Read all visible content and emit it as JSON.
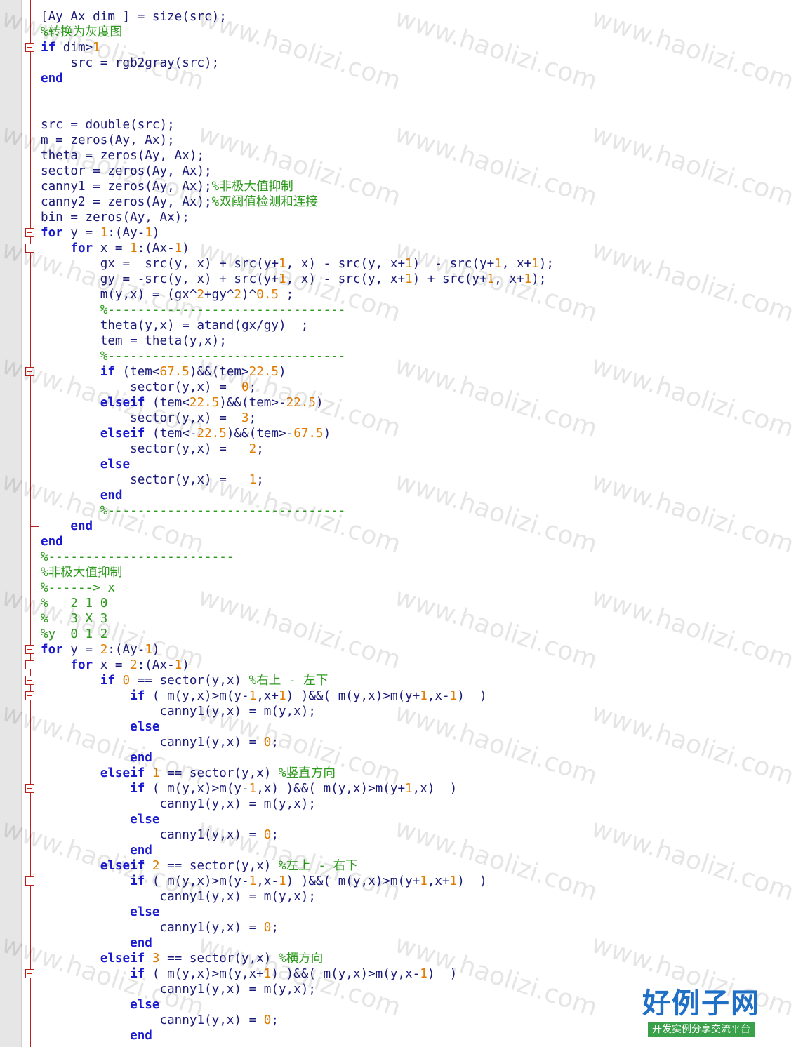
{
  "editor": {
    "lines": [
      [
        {
          "t": "[Ay Ax dim ] = size(src);",
          "c": "txt"
        }
      ],
      [
        {
          "t": "%转换为灰度图",
          "c": "cm"
        }
      ],
      [
        {
          "t": "if",
          "c": "kw"
        },
        {
          "t": " dim>",
          "c": "txt"
        },
        {
          "t": "1",
          "c": "num"
        }
      ],
      [
        {
          "t": "    src = rgb2gray(src);",
          "c": "txt"
        }
      ],
      [
        {
          "t": "end",
          "c": "kw"
        }
      ],
      [
        {
          "t": "",
          "c": "txt"
        }
      ],
      [
        {
          "t": "",
          "c": "txt"
        }
      ],
      [
        {
          "t": "src = double(src);",
          "c": "txt"
        }
      ],
      [
        {
          "t": "m = zeros(Ay, Ax);",
          "c": "txt"
        }
      ],
      [
        {
          "t": "theta = zeros(Ay, Ax);",
          "c": "txt"
        }
      ],
      [
        {
          "t": "sector = zeros(Ay, Ax);",
          "c": "txt"
        }
      ],
      [
        {
          "t": "canny1 = zeros(Ay, Ax);",
          "c": "txt"
        },
        {
          "t": "%非极大值抑制",
          "c": "cm"
        }
      ],
      [
        {
          "t": "canny2 = zeros(Ay, Ax);",
          "c": "txt"
        },
        {
          "t": "%双阈值检测和连接",
          "c": "cm"
        }
      ],
      [
        {
          "t": "bin = zeros(Ay, Ax);",
          "c": "txt"
        }
      ],
      [
        {
          "t": "for",
          "c": "kw"
        },
        {
          "t": " y = ",
          "c": "txt"
        },
        {
          "t": "1",
          "c": "num"
        },
        {
          "t": ":(Ay-",
          "c": "txt"
        },
        {
          "t": "1",
          "c": "num"
        },
        {
          "t": ")",
          "c": "txt"
        }
      ],
      [
        {
          "t": "    ",
          "c": "txt"
        },
        {
          "t": "for",
          "c": "kw"
        },
        {
          "t": " x = ",
          "c": "txt"
        },
        {
          "t": "1",
          "c": "num"
        },
        {
          "t": ":(Ax-",
          "c": "txt"
        },
        {
          "t": "1",
          "c": "num"
        },
        {
          "t": ")",
          "c": "txt"
        }
      ],
      [
        {
          "t": "        gx =  src(y, x) + src(y+",
          "c": "txt"
        },
        {
          "t": "1",
          "c": "num"
        },
        {
          "t": ", x) - src(y, x+",
          "c": "txt"
        },
        {
          "t": "1",
          "c": "num"
        },
        {
          "t": ")  - src(y+",
          "c": "txt"
        },
        {
          "t": "1",
          "c": "num"
        },
        {
          "t": ", x+",
          "c": "txt"
        },
        {
          "t": "1",
          "c": "num"
        },
        {
          "t": ");",
          "c": "txt"
        }
      ],
      [
        {
          "t": "        gy = -src(y, x) + src(y+",
          "c": "txt"
        },
        {
          "t": "1",
          "c": "num"
        },
        {
          "t": ", x) - src(y, x+",
          "c": "txt"
        },
        {
          "t": "1",
          "c": "num"
        },
        {
          "t": ") + src(y+",
          "c": "txt"
        },
        {
          "t": "1",
          "c": "num"
        },
        {
          "t": ", x+",
          "c": "txt"
        },
        {
          "t": "1",
          "c": "num"
        },
        {
          "t": ");",
          "c": "txt"
        }
      ],
      [
        {
          "t": "        m(y,x) = (gx^",
          "c": "txt"
        },
        {
          "t": "2",
          "c": "num"
        },
        {
          "t": "+gy^",
          "c": "txt"
        },
        {
          "t": "2",
          "c": "num"
        },
        {
          "t": ")^",
          "c": "txt"
        },
        {
          "t": "0.5",
          "c": "num"
        },
        {
          "t": " ;",
          "c": "txt"
        }
      ],
      [
        {
          "t": "        ",
          "c": "txt"
        },
        {
          "t": "%--------------------------------",
          "c": "cm"
        }
      ],
      [
        {
          "t": "        theta(y,x) = atand(gx/gy)  ;",
          "c": "txt"
        }
      ],
      [
        {
          "t": "        tem = theta(y,x);",
          "c": "txt"
        }
      ],
      [
        {
          "t": "        ",
          "c": "txt"
        },
        {
          "t": "%--------------------------------",
          "c": "cm"
        }
      ],
      [
        {
          "t": "        ",
          "c": "txt"
        },
        {
          "t": "if",
          "c": "kw"
        },
        {
          "t": " (tem<",
          "c": "txt"
        },
        {
          "t": "67.5",
          "c": "num"
        },
        {
          "t": ")&&(tem>",
          "c": "txt"
        },
        {
          "t": "22.5",
          "c": "num"
        },
        {
          "t": ")",
          "c": "txt"
        }
      ],
      [
        {
          "t": "            sector(y,x) =  ",
          "c": "txt"
        },
        {
          "t": "0",
          "c": "num"
        },
        {
          "t": ";",
          "c": "txt"
        }
      ],
      [
        {
          "t": "        ",
          "c": "txt"
        },
        {
          "t": "elseif",
          "c": "kw"
        },
        {
          "t": " (tem<",
          "c": "txt"
        },
        {
          "t": "22.5",
          "c": "num"
        },
        {
          "t": ")&&(tem>-",
          "c": "txt"
        },
        {
          "t": "22.5",
          "c": "num"
        },
        {
          "t": ")",
          "c": "txt"
        }
      ],
      [
        {
          "t": "            sector(y,x) =  ",
          "c": "txt"
        },
        {
          "t": "3",
          "c": "num"
        },
        {
          "t": ";",
          "c": "txt"
        }
      ],
      [
        {
          "t": "        ",
          "c": "txt"
        },
        {
          "t": "elseif",
          "c": "kw"
        },
        {
          "t": " (tem<-",
          "c": "txt"
        },
        {
          "t": "22.5",
          "c": "num"
        },
        {
          "t": ")&&(tem>-",
          "c": "txt"
        },
        {
          "t": "67.5",
          "c": "num"
        },
        {
          "t": ")",
          "c": "txt"
        }
      ],
      [
        {
          "t": "            sector(y,x) =   ",
          "c": "txt"
        },
        {
          "t": "2",
          "c": "num"
        },
        {
          "t": ";",
          "c": "txt"
        }
      ],
      [
        {
          "t": "        ",
          "c": "txt"
        },
        {
          "t": "else",
          "c": "kw"
        }
      ],
      [
        {
          "t": "            sector(y,x) =   ",
          "c": "txt"
        },
        {
          "t": "1",
          "c": "num"
        },
        {
          "t": ";",
          "c": "txt"
        }
      ],
      [
        {
          "t": "        ",
          "c": "txt"
        },
        {
          "t": "end",
          "c": "kw"
        }
      ],
      [
        {
          "t": "        ",
          "c": "txt"
        },
        {
          "t": "%--------------------------------",
          "c": "cm"
        }
      ],
      [
        {
          "t": "    ",
          "c": "txt"
        },
        {
          "t": "end",
          "c": "kw"
        }
      ],
      [
        {
          "t": "end",
          "c": "kw"
        }
      ],
      [
        {
          "t": "%-------------------------",
          "c": "cm"
        }
      ],
      [
        {
          "t": "%非极大值抑制",
          "c": "cm"
        }
      ],
      [
        {
          "t": "%------> x",
          "c": "cm"
        }
      ],
      [
        {
          "t": "%   2 1 0",
          "c": "cm"
        }
      ],
      [
        {
          "t": "%   3 X 3",
          "c": "cm"
        }
      ],
      [
        {
          "t": "%y  0 1 2",
          "c": "cm"
        }
      ],
      [
        {
          "t": "for",
          "c": "kw"
        },
        {
          "t": " y = ",
          "c": "txt"
        },
        {
          "t": "2",
          "c": "num"
        },
        {
          "t": ":(Ay-",
          "c": "txt"
        },
        {
          "t": "1",
          "c": "num"
        },
        {
          "t": ")",
          "c": "txt"
        }
      ],
      [
        {
          "t": "    ",
          "c": "txt"
        },
        {
          "t": "for",
          "c": "kw"
        },
        {
          "t": " x = ",
          "c": "txt"
        },
        {
          "t": "2",
          "c": "num"
        },
        {
          "t": ":(Ax-",
          "c": "txt"
        },
        {
          "t": "1",
          "c": "num"
        },
        {
          "t": ")",
          "c": "txt"
        }
      ],
      [
        {
          "t": "        ",
          "c": "txt"
        },
        {
          "t": "if",
          "c": "kw"
        },
        {
          "t": " ",
          "c": "txt"
        },
        {
          "t": "0",
          "c": "num"
        },
        {
          "t": " == sector(y,x) ",
          "c": "txt"
        },
        {
          "t": "%右上 - 左下",
          "c": "cm"
        }
      ],
      [
        {
          "t": "            ",
          "c": "txt"
        },
        {
          "t": "if",
          "c": "kw"
        },
        {
          "t": " ( m(y,x)>m(y-",
          "c": "txt"
        },
        {
          "t": "1",
          "c": "num"
        },
        {
          "t": ",x+",
          "c": "txt"
        },
        {
          "t": "1",
          "c": "num"
        },
        {
          "t": ") )&&( m(y,x)>m(y+",
          "c": "txt"
        },
        {
          "t": "1",
          "c": "num"
        },
        {
          "t": ",x-",
          "c": "txt"
        },
        {
          "t": "1",
          "c": "num"
        },
        {
          "t": ")  )",
          "c": "txt"
        }
      ],
      [
        {
          "t": "                canny1(y,x) = m(y,x);",
          "c": "txt"
        }
      ],
      [
        {
          "t": "            ",
          "c": "txt"
        },
        {
          "t": "else",
          "c": "kw"
        }
      ],
      [
        {
          "t": "                canny1(y,x) = ",
          "c": "txt"
        },
        {
          "t": "0",
          "c": "num"
        },
        {
          "t": ";",
          "c": "txt"
        }
      ],
      [
        {
          "t": "            ",
          "c": "txt"
        },
        {
          "t": "end",
          "c": "kw"
        }
      ],
      [
        {
          "t": "        ",
          "c": "txt"
        },
        {
          "t": "elseif",
          "c": "kw"
        },
        {
          "t": " ",
          "c": "txt"
        },
        {
          "t": "1",
          "c": "num"
        },
        {
          "t": " == sector(y,x) ",
          "c": "txt"
        },
        {
          "t": "%竖直方向",
          "c": "cm"
        }
      ],
      [
        {
          "t": "            ",
          "c": "txt"
        },
        {
          "t": "if",
          "c": "kw"
        },
        {
          "t": " ( m(y,x)>m(y-",
          "c": "txt"
        },
        {
          "t": "1",
          "c": "num"
        },
        {
          "t": ",x) )&&( m(y,x)>m(y+",
          "c": "txt"
        },
        {
          "t": "1",
          "c": "num"
        },
        {
          "t": ",x)  )",
          "c": "txt"
        }
      ],
      [
        {
          "t": "                canny1(y,x) = m(y,x);",
          "c": "txt"
        }
      ],
      [
        {
          "t": "            ",
          "c": "txt"
        },
        {
          "t": "else",
          "c": "kw"
        }
      ],
      [
        {
          "t": "                canny1(y,x) = ",
          "c": "txt"
        },
        {
          "t": "0",
          "c": "num"
        },
        {
          "t": ";",
          "c": "txt"
        }
      ],
      [
        {
          "t": "            ",
          "c": "txt"
        },
        {
          "t": "end",
          "c": "kw"
        }
      ],
      [
        {
          "t": "        ",
          "c": "txt"
        },
        {
          "t": "elseif",
          "c": "kw"
        },
        {
          "t": " ",
          "c": "txt"
        },
        {
          "t": "2",
          "c": "num"
        },
        {
          "t": " == sector(y,x) ",
          "c": "txt"
        },
        {
          "t": "%左上 - 右下",
          "c": "cm"
        }
      ],
      [
        {
          "t": "            ",
          "c": "txt"
        },
        {
          "t": "if",
          "c": "kw"
        },
        {
          "t": " ( m(y,x)>m(y-",
          "c": "txt"
        },
        {
          "t": "1",
          "c": "num"
        },
        {
          "t": ",x-",
          "c": "txt"
        },
        {
          "t": "1",
          "c": "num"
        },
        {
          "t": ") )&&( m(y,x)>m(y+",
          "c": "txt"
        },
        {
          "t": "1",
          "c": "num"
        },
        {
          "t": ",x+",
          "c": "txt"
        },
        {
          "t": "1",
          "c": "num"
        },
        {
          "t": ")  )",
          "c": "txt"
        }
      ],
      [
        {
          "t": "                canny1(y,x) = m(y,x);",
          "c": "txt"
        }
      ],
      [
        {
          "t": "            ",
          "c": "txt"
        },
        {
          "t": "else",
          "c": "kw"
        }
      ],
      [
        {
          "t": "                canny1(y,x) = ",
          "c": "txt"
        },
        {
          "t": "0",
          "c": "num"
        },
        {
          "t": ";",
          "c": "txt"
        }
      ],
      [
        {
          "t": "            ",
          "c": "txt"
        },
        {
          "t": "end",
          "c": "kw"
        }
      ],
      [
        {
          "t": "        ",
          "c": "txt"
        },
        {
          "t": "elseif",
          "c": "kw"
        },
        {
          "t": " ",
          "c": "txt"
        },
        {
          "t": "3",
          "c": "num"
        },
        {
          "t": " == sector(y,x) ",
          "c": "txt"
        },
        {
          "t": "%横方向",
          "c": "cm"
        }
      ],
      [
        {
          "t": "            ",
          "c": "txt"
        },
        {
          "t": "if",
          "c": "kw"
        },
        {
          "t": " ( m(y,x)>m(y,x+",
          "c": "txt"
        },
        {
          "t": "1",
          "c": "num"
        },
        {
          "t": ") )&&( m(y,x)>m(y,x-",
          "c": "txt"
        },
        {
          "t": "1",
          "c": "num"
        },
        {
          "t": ")  )",
          "c": "txt"
        }
      ],
      [
        {
          "t": "                canny1(y,x) = m(y,x);",
          "c": "txt"
        }
      ],
      [
        {
          "t": "            ",
          "c": "txt"
        },
        {
          "t": "else",
          "c": "kw"
        }
      ],
      [
        {
          "t": "                canny1(y,x) = ",
          "c": "txt"
        },
        {
          "t": "0",
          "c": "num"
        },
        {
          "t": ";",
          "c": "txt"
        }
      ],
      [
        {
          "t": "            ",
          "c": "txt"
        },
        {
          "t": "end",
          "c": "kw"
        }
      ]
    ],
    "fold_open_lines": [
      2,
      14,
      15,
      23,
      41,
      42,
      43,
      44,
      50,
      56,
      62
    ],
    "fold_end_lines": [
      4,
      33,
      34
    ]
  },
  "watermark": {
    "text": "www.haolizi.com"
  },
  "logo": {
    "title": "好例子网",
    "subtitle": "开发实例分享交流平台"
  },
  "colors": {
    "keyword": "#1a1ad0",
    "number": "#e07b00",
    "comment": "#2e9b1e",
    "text": "#1a1a7a",
    "fold": "#c21d1d"
  }
}
